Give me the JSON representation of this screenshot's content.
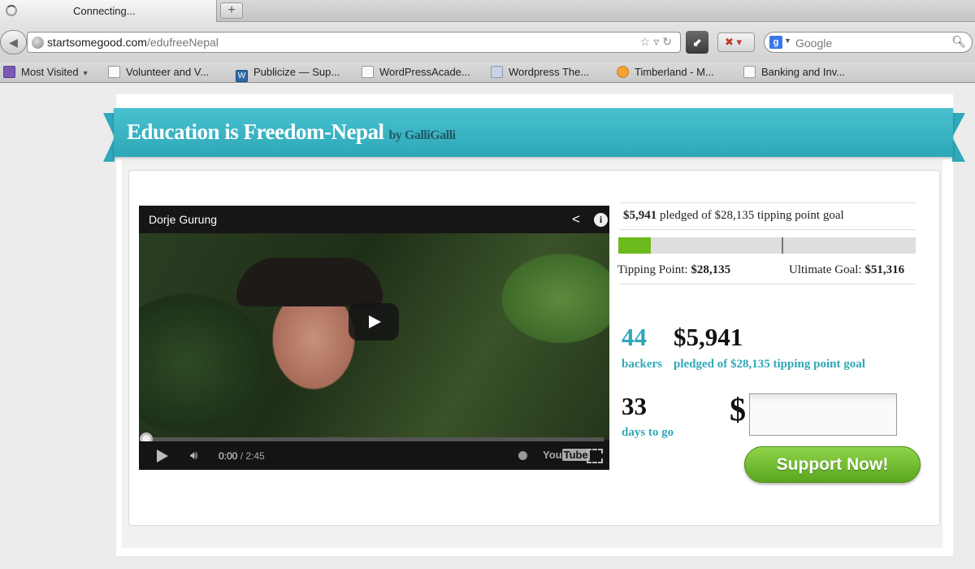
{
  "browser": {
    "tab_title": "Connecting...",
    "new_tab_label": "+",
    "url_domain": "startsomegood.com",
    "url_path": "/edufreeNepal",
    "search_placeholder": "Google",
    "search_engine_letter": "g"
  },
  "bookmarks": [
    {
      "label": "Most Visited",
      "icon": "most-visited-icon"
    },
    {
      "label": "Volunteer and V...",
      "icon": "page-icon"
    },
    {
      "label": "Publicize — Sup...",
      "icon": "wordpress-icon"
    },
    {
      "label": "WordPressAcade...",
      "icon": "page-icon"
    },
    {
      "label": "Wordpress The...",
      "icon": "bottle-icon"
    },
    {
      "label": "Timberland - M...",
      "icon": "timberland-icon"
    },
    {
      "label": "Banking and Inv...",
      "icon": "page-icon"
    }
  ],
  "campaign": {
    "title": "Education is Freedom-Nepal",
    "by_prefix": "by",
    "author": "GalliGalli"
  },
  "video": {
    "author": "Dorje Gurung",
    "current_time": "0:00",
    "duration": "2:45",
    "yt_you": "You",
    "yt_tube": "Tube"
  },
  "funding": {
    "pledged": "$5,941",
    "pledge_text": "pledged of $28,135 tipping point goal",
    "progress_fraction": 0.11,
    "tipping_point_fraction": 0.548,
    "tipping_point_label": "Tipping Point:",
    "tipping_point_value": "$28,135",
    "ultimate_goal_label": "Ultimate Goal:",
    "ultimate_goal_value": "$51,316",
    "backers_count": "44",
    "backers_label": "backers",
    "pledged_big": "$5,941",
    "pledged_label": "pledged of $28,135 tipping point goal",
    "days_count": "33",
    "days_label": "days to go",
    "currency_symbol": "$",
    "amount_value": "",
    "support_button": "Support Now!"
  },
  "colors": {
    "ribbon": "#2fa8b9",
    "accent_text": "#2fa8b9",
    "progress_fill": "#6cba1e",
    "support_button": "#6cba1e"
  }
}
